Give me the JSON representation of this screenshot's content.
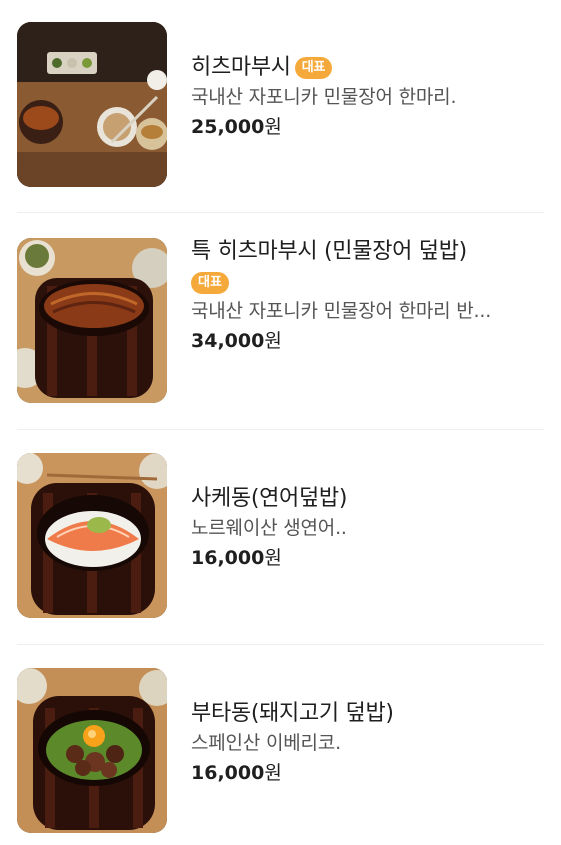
{
  "menu": {
    "items": [
      {
        "name": "히츠마부시",
        "badge": "대표",
        "description": "국내산 자포니카 민물장어 한마리.",
        "price": "25,000",
        "currency": "원",
        "image_icon": "eel-rice-set-photo"
      },
      {
        "name": "특 히츠마부시 (민물장어 덮밥)",
        "badge": "대표",
        "description": "국내산 자포니카 민물장어 한마리 반...",
        "price": "34,000",
        "currency": "원",
        "image_icon": "eel-rice-bowl-photo"
      },
      {
        "name": "사케동(연어덮밥)",
        "description": "노르웨이산 생연어..",
        "price": "16,000",
        "currency": "원",
        "image_icon": "salmon-rice-bowl-photo"
      },
      {
        "name": "부타동(돼지고기 덮밥)",
        "description": "스페인산 이베리코.",
        "price": "16,000",
        "currency": "원",
        "image_icon": "pork-rice-bowl-photo"
      }
    ]
  },
  "colors": {
    "badge": "#f6a93b",
    "divider": "#eeeeee",
    "text": "#1f1f1f",
    "description": "#555555"
  }
}
